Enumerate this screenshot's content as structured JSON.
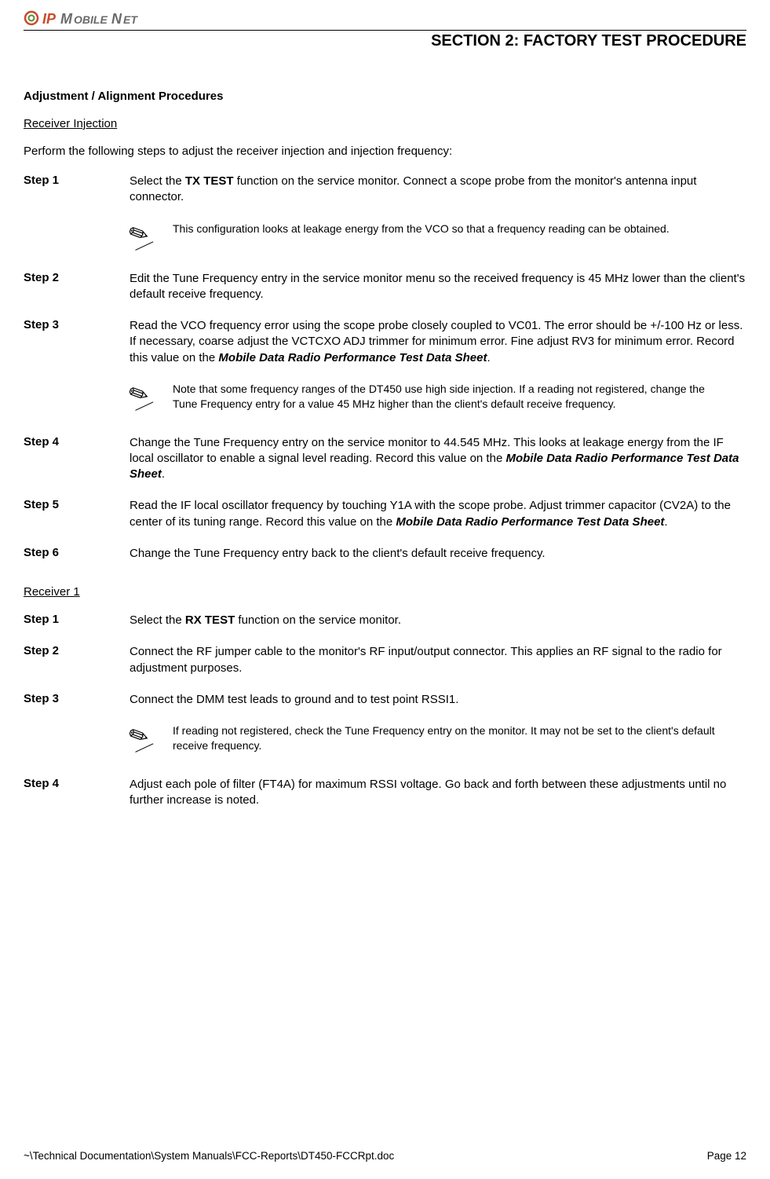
{
  "logo": {
    "name": "IP MOBILENET"
  },
  "section_title": "SECTION 2:  FACTORY TEST PROCEDURE",
  "heading": "Adjustment / Alignment Procedures",
  "sub1": {
    "title": "Receiver Injection",
    "intro": "Perform the following steps to adjust the receiver injection and injection frequency:",
    "steps": [
      {
        "label": "Step 1",
        "pre": "Select the ",
        "bold": "TX TEST",
        "post": " function on the service monitor.  Connect a scope probe from the monitor's antenna input connector."
      },
      {
        "label": "Step 2",
        "text": "Edit the Tune Frequency entry in the service monitor menu so the received frequency is 45 MHz lower than the client's default receive frequency."
      },
      {
        "label": "Step 3",
        "pre": "Read the VCO frequency error using the scope probe closely coupled to VC01.  The error should be +/-100 Hz or less.  If necessary, coarse adjust the VCTCXO ADJ trimmer for minimum error.  Fine adjust RV3 for minimum error.  Record this value on the ",
        "ital": "Mobile Data Radio Performance Test Data Sheet",
        "post": "."
      },
      {
        "label": "Step 4",
        "pre": "Change the Tune Frequency entry on the service monitor to 44.545 MHz.  This looks at leakage energy from the IF local oscillator to enable a signal level reading.  Record this value on the ",
        "ital": "Mobile Data Radio Performance Test Data Sheet",
        "post": "."
      },
      {
        "label": "Step 5",
        "pre": "Read the IF local oscillator frequency by touching Y1A with the scope probe.  Adjust trimmer capacitor (CV2A) to the center of its tuning range.  Record this value on the ",
        "ital": "Mobile Data Radio Performance Test Data Sheet",
        "post": "."
      },
      {
        "label": "Step 6",
        "text": "Change the Tune Frequency entry back to the client's default receive frequency."
      }
    ],
    "notes": [
      "This configuration looks at leakage energy from the VCO so that a frequency reading can be obtained.",
      "Note that some frequency ranges of the DT450 use high side injection.  If a reading not registered, change the Tune Frequency entry for a value 45 MHz higher than the client's default receive frequency."
    ]
  },
  "sub2": {
    "title": "Receiver 1",
    "steps": [
      {
        "label": "Step 1",
        "pre": "Select the ",
        "bold": "RX TEST",
        "post": " function on the service monitor."
      },
      {
        "label": "Step 2",
        "text": "Connect the RF jumper cable to the monitor's RF input/output connector.  This applies an RF signal to the radio for adjustment purposes."
      },
      {
        "label": "Step 3",
        "text": "Connect the DMM test leads to ground and to test point RSSI1."
      },
      {
        "label": "Step 4",
        "text": "Adjust each pole of filter (FT4A) for maximum RSSI voltage.  Go back and forth between these adjustments until no further increase is noted."
      }
    ],
    "note": "If reading not registered, check the Tune Frequency entry on the monitor.  It may not be set to the client's default receive frequency."
  },
  "footer": {
    "path": "~\\Technical Documentation\\System Manuals\\FCC-Reports\\DT450-FCCRpt.doc",
    "page": "Page 12"
  }
}
